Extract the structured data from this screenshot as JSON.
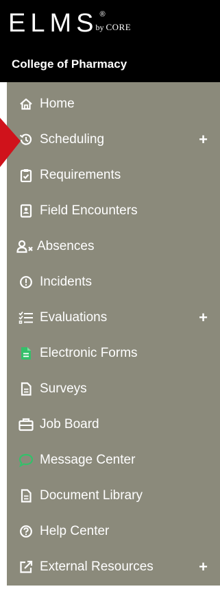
{
  "header": {
    "logo": "ELMS",
    "logo_reg": "®",
    "logo_by": "by",
    "logo_core": "CORE",
    "college": "College of Pharmacy"
  },
  "nav": {
    "items": [
      {
        "label": "Home",
        "icon": "home-icon"
      },
      {
        "label": "Scheduling",
        "icon": "history-clock-icon",
        "expand": "+"
      },
      {
        "label": "Requirements",
        "icon": "clipboard-check-icon"
      },
      {
        "label": "Field Encounters",
        "icon": "id-badge-icon"
      },
      {
        "label": "Absences",
        "icon": "user-x-icon"
      },
      {
        "label": "Incidents",
        "icon": "alert-circle-icon"
      },
      {
        "label": "Evaluations",
        "icon": "checklist-icon",
        "expand": "+"
      },
      {
        "label": "Electronic Forms",
        "icon": "form-document-icon"
      },
      {
        "label": "Surveys",
        "icon": "document-icon"
      },
      {
        "label": "Job Board",
        "icon": "briefcase-icon"
      },
      {
        "label": "Message Center",
        "icon": "chat-bubble-icon"
      },
      {
        "label": "Document Library",
        "icon": "document-icon"
      },
      {
        "label": "Help Center",
        "icon": "help-circle-icon"
      },
      {
        "label": "External Resources",
        "icon": "external-link-icon",
        "expand": "+"
      }
    ]
  },
  "colors": {
    "header_bg": "#000000",
    "nav_bg": "#8b8a7b",
    "nav_text": "#ffffff",
    "forms_icon": "#34c06a",
    "message_icon": "#34c06a",
    "pointer": "#d0121b"
  }
}
